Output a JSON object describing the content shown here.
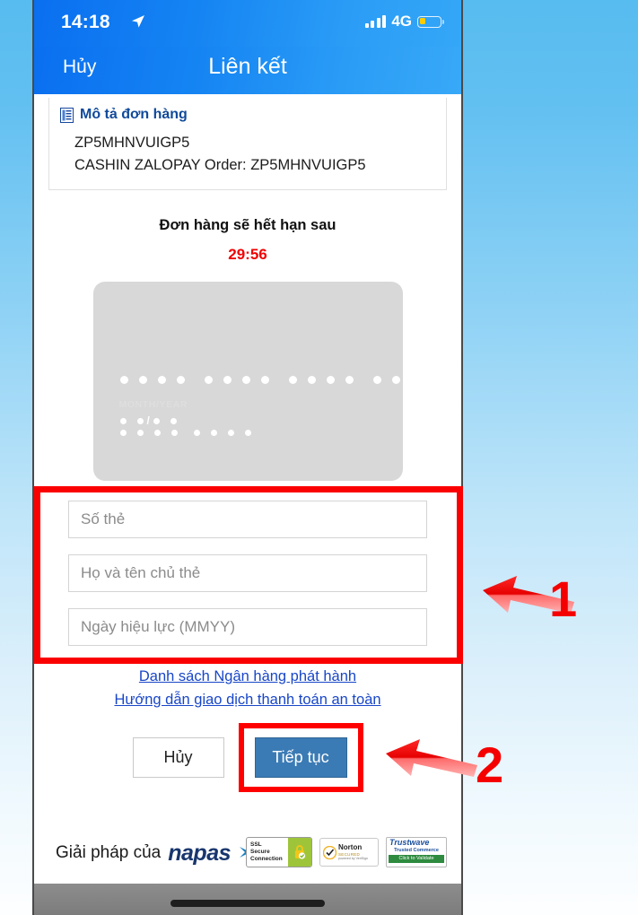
{
  "status_bar": {
    "time": "14:18",
    "location_icon": "location-arrow-icon",
    "signal_icon": "signal-bars-icon",
    "network": "4G",
    "battery_icon": "battery-low-icon"
  },
  "nav": {
    "cancel_label": "Hủy",
    "title": "Liên kết"
  },
  "order": {
    "section_icon": "document-list-icon",
    "section_title": "Mô tả đơn hàng",
    "lines": [
      "ZP5MHNVUIGP5",
      "CASHIN ZALOPAY Order: ZP5MHNVUIGP5"
    ]
  },
  "countdown": {
    "label": "Đơn hàng sẽ hết hạn sau",
    "value": "29:56",
    "color": "#f00000"
  },
  "card_preview": {
    "month_year_label": "MONTH/YEAR",
    "slash": "/"
  },
  "form": {
    "fields": [
      {
        "name": "card-number",
        "placeholder": "Số thẻ",
        "value": ""
      },
      {
        "name": "card-holder",
        "placeholder": "Họ và tên chủ thẻ",
        "value": ""
      },
      {
        "name": "expiry-date",
        "placeholder": "Ngày hiệu lực (MMYY)",
        "value": ""
      }
    ],
    "links": [
      "Danh sách Ngân hàng phát hành",
      "Hướng dẫn giao dịch thanh toán an toàn"
    ],
    "cancel_button": "Hủy",
    "continue_button": "Tiếp tục",
    "continue_color": "#3b7bb5"
  },
  "footer": {
    "solution_prefix": "Giải pháp của",
    "brand": "napas",
    "badges": [
      {
        "name": "ssl-secure-connection-badge",
        "line1": "SSL",
        "line2": "Secure",
        "line3": "Connection"
      },
      {
        "name": "norton-secured-badge",
        "title": "Norton",
        "subtitle": "SECURED",
        "footnote": "powered by VeriSign"
      },
      {
        "name": "trustwave-badge",
        "title": "Trustwave",
        "subtitle": "Trusted Commerce",
        "action": "Click to Validate"
      }
    ]
  },
  "annotations": {
    "step_one": "1",
    "step_two": "2",
    "highlight_color": "#fb0000"
  }
}
